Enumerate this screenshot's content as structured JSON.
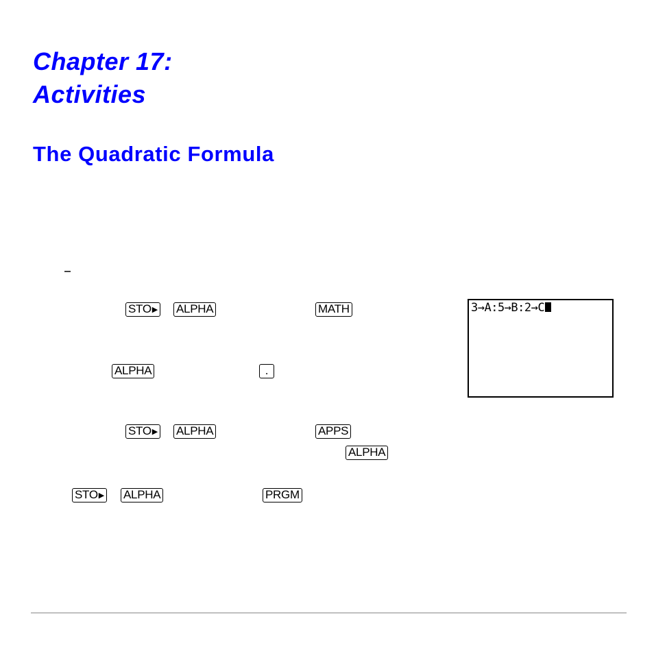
{
  "chapter": {
    "line1": "Chapter 17:",
    "line2": "Activities"
  },
  "section_title": "The Quadratic Formula",
  "keys": {
    "step1": [
      "STO",
      "ALPHA",
      "MATH"
    ],
    "step2": [
      "ALPHA",
      "."
    ],
    "step3": [
      "STO",
      "ALPHA",
      "APPS",
      "ALPHA"
    ],
    "step4": [
      "STO",
      "ALPHA",
      "PRGM"
    ]
  },
  "sto_arrow": "▶",
  "calculator_screen": {
    "line1": "3→A:5→B:2→C"
  },
  "colors": {
    "heading": "#0000ff",
    "footer_rule": "#c0c0c0"
  }
}
